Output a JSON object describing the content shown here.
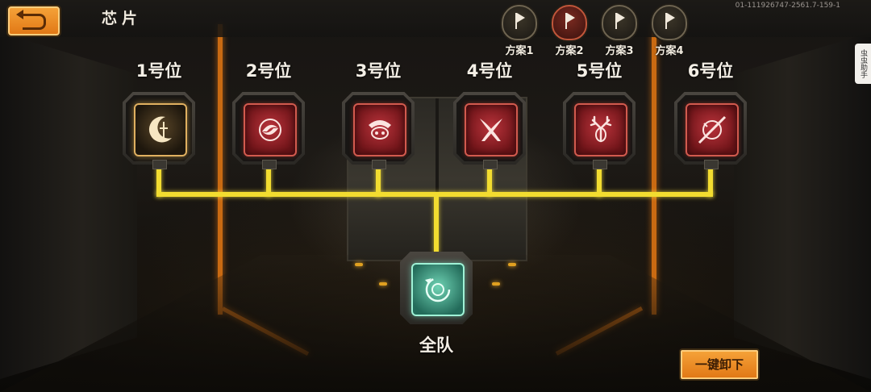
{
  "header": {
    "title": "芯片",
    "build_id": "01-111926747-2561.7-159-1",
    "side_tag": "虫虫助手"
  },
  "plans": [
    {
      "label": "方案1",
      "active": false
    },
    {
      "label": "方案2",
      "active": true
    },
    {
      "label": "方案3",
      "active": false
    },
    {
      "label": "方案4",
      "active": false
    }
  ],
  "slots": [
    {
      "label": "1号位",
      "icon": "crescent-blade-icon",
      "style": "gold"
    },
    {
      "label": "2号位",
      "icon": "swirl-orb-icon",
      "style": "red"
    },
    {
      "label": "3号位",
      "icon": "beast-head-icon",
      "style": "red"
    },
    {
      "label": "4号位",
      "icon": "crossed-claws-icon",
      "style": "red"
    },
    {
      "label": "5号位",
      "icon": "antlers-icon",
      "style": "red"
    },
    {
      "label": "6号位",
      "icon": "slashed-circle-icon",
      "style": "red"
    }
  ],
  "team": {
    "label": "全队",
    "icon": "cycle-ring-icon",
    "style": "teal"
  },
  "actions": {
    "unequip_all": "一键卸下"
  },
  "colors": {
    "wire": "#f2dc30",
    "button": "#f09028",
    "slot_red": "#b8323a",
    "slot_gold": "#e0b060",
    "team_teal": "#6fd3b4"
  }
}
